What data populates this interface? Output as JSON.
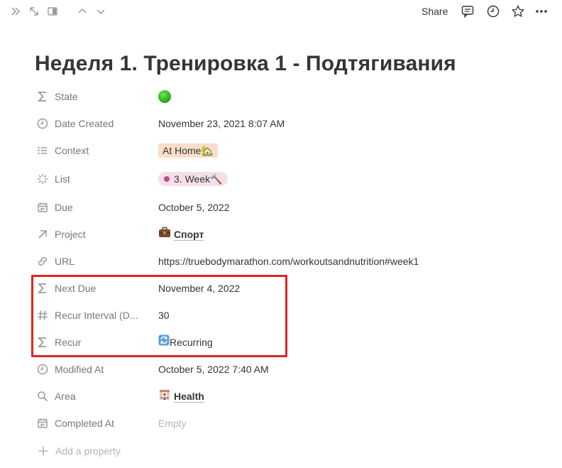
{
  "topbar": {
    "share_label": "Share",
    "left_icons": [
      "double-chevron-right-icon",
      "expand-icon",
      "sidebar-icon",
      "chevron-up-icon",
      "chevron-down-icon"
    ],
    "right_icons": [
      "comment-icon",
      "clock-icon",
      "star-icon",
      "more-icon"
    ]
  },
  "page": {
    "title": "Неделя 1. Тренировка 1 - Подтягивания"
  },
  "properties": {
    "state": {
      "name": "State",
      "value_icon": "green-circle"
    },
    "date_created": {
      "name": "Date Created",
      "value": "November 23, 2021 8:07 AM"
    },
    "context": {
      "name": "Context",
      "value": "At Home🏡"
    },
    "list": {
      "name": "List",
      "value": "3. Week🔨"
    },
    "due": {
      "name": "Due",
      "value": "October 5, 2022"
    },
    "project": {
      "name": "Project",
      "value": "Спорт",
      "emoji": "briefcase"
    },
    "url": {
      "name": "URL",
      "value": "https://truebodymarathon.com/workoutsandnutrition#week1"
    },
    "next_due": {
      "name": "Next Due",
      "value": "November 4, 2022"
    },
    "recur_interval": {
      "name": "Recur Interval (D...",
      "value": "30"
    },
    "recur": {
      "name": "Recur",
      "value": "Recurring",
      "emoji": "repeat"
    },
    "modified_at": {
      "name": "Modified At",
      "value": "October 5, 2022 7:40 AM"
    },
    "area": {
      "name": "Area",
      "value": "Health",
      "emoji": "hospital"
    },
    "completed_at": {
      "name": "Completed At",
      "value": "Empty"
    }
  },
  "add_property_label": "Add a property",
  "colors": {
    "highlight": "#e0271f",
    "text": "#37352f",
    "muted": "#787774",
    "tag_home_bg": "#fadec9",
    "tag_week_bg": "#f5e0e9"
  }
}
